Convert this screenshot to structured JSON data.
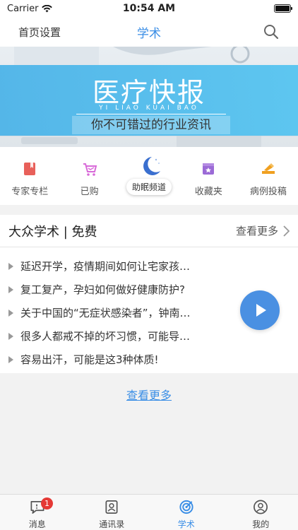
{
  "status_bar": {
    "carrier": "Carrier",
    "time": "10:54 AM"
  },
  "nav": {
    "left_label": "首页设置",
    "title": "学术"
  },
  "banner": {
    "title": "医疗快报",
    "pinyin": "YI LIAO KUAI BAO",
    "subtitle": "你不可错过的行业资讯"
  },
  "quick_links": [
    {
      "label": "专家专栏",
      "icon": "book-icon",
      "color": "#e8605a"
    },
    {
      "label": "已购",
      "icon": "cart-icon",
      "color": "#d86ad8"
    },
    {
      "label": "助眠频道",
      "icon": "moon-icon",
      "color": "#3a6fcf"
    },
    {
      "label": "收藏夹",
      "icon": "star-box-icon",
      "color": "#9b6ad6"
    },
    {
      "label": "病例投稿",
      "icon": "submit-icon",
      "color": "#f0a020"
    }
  ],
  "section": {
    "title": "大众学术 | 免费",
    "more_label": "查看更多",
    "items": [
      "延迟开学，疫情期间如何让宅家孩…",
      "复工复产，孕妇如何做好健康防护?",
      "关于中国的“无症状感染者”，钟南…",
      "很多人都戒不掉的坏习惯，可能导…",
      "容易出汗，可能是这3种体质!"
    ]
  },
  "view_more": "查看更多",
  "tabs": [
    {
      "label": "消息",
      "icon": "message-icon",
      "badge": "1"
    },
    {
      "label": "通讯录",
      "icon": "contacts-icon"
    },
    {
      "label": "学术",
      "icon": "academic-icon",
      "active": true
    },
    {
      "label": "我的",
      "icon": "profile-icon"
    }
  ],
  "colors": {
    "accent": "#3a8ee6",
    "play_button": "#4a90e2",
    "badge": "#e53935"
  }
}
